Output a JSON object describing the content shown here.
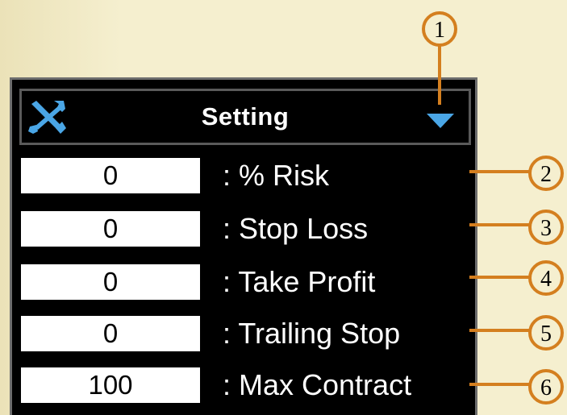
{
  "colors": {
    "background": "#f5efcf",
    "panel": "#000000",
    "panel_border": "#6d6d6d",
    "icon_accent": "#4aa6e6",
    "callout": "#d47f1f",
    "field_bg": "#ffffff",
    "label_text": "#ffffff"
  },
  "header": {
    "icon": "tools-icon",
    "title": "Setting",
    "dropdown_icon": "triangle-down-icon"
  },
  "fields": [
    {
      "value": "0",
      "label": ": % Risk"
    },
    {
      "value": "0",
      "label": ": Stop Loss"
    },
    {
      "value": "0",
      "label": ": Take Profit"
    },
    {
      "value": "0",
      "label": ": Trailing Stop"
    },
    {
      "value": "100",
      "label": ": Max Contract"
    }
  ],
  "callouts": [
    "1",
    "2",
    "3",
    "4",
    "5",
    "6"
  ]
}
